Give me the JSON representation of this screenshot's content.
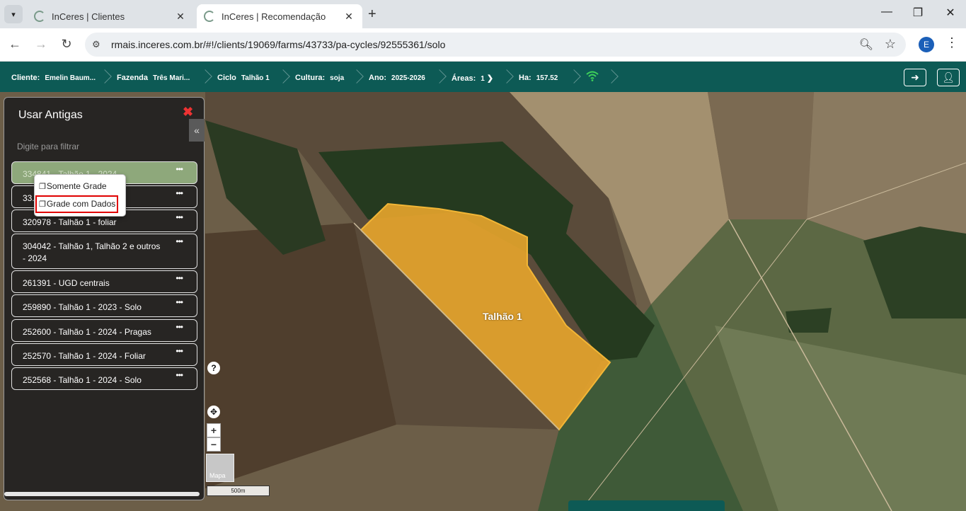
{
  "browser": {
    "tabs": [
      {
        "title": "InCeres | Clientes",
        "active": false
      },
      {
        "title": "InCeres | Recomendação",
        "active": true
      }
    ],
    "url": "rmais.inceres.com.br/#!/clients/19069/farms/43733/pa-cycles/92555361/solo",
    "profile_initial": "E"
  },
  "header": {
    "cliente_label": "Cliente:",
    "cliente_value": "Emelin Baum...",
    "fazenda_label": "Fazenda",
    "fazenda_value": "Três Mari...",
    "ciclo_label": "Ciclo",
    "ciclo_value": "Talhão 1",
    "cultura_label": "Cultura:",
    "cultura_value": "soja",
    "ano_label": "Ano:",
    "ano_value": "2025-2026",
    "areas_label": "Áreas:",
    "areas_value": "1",
    "ha_label": "Ha:",
    "ha_value": "157.52"
  },
  "panel": {
    "title": "Usar Antigas",
    "filter_placeholder": "Digite para filtrar",
    "items": [
      {
        "label": "334841 - Talhão 1 - 2024",
        "selected": true
      },
      {
        "label": "33...",
        "selected": false
      },
      {
        "label": "320978 - Talhão 1 - foliar",
        "selected": false
      },
      {
        "label": "304042 - Talhão 1, Talhão 2 e outros - 2024",
        "selected": false
      },
      {
        "label": "261391 - UGD centrais",
        "selected": false
      },
      {
        "label": "259890 - Talhão 1 - 2023 - Solo",
        "selected": false
      },
      {
        "label": "252600 - Talhão 1 - 2024 - Pragas",
        "selected": false
      },
      {
        "label": "252570 - Talhão 1 - 2024 - Foliar",
        "selected": false
      },
      {
        "label": "252568 - Talhão 1 - 2024 - Solo",
        "selected": false
      }
    ],
    "item_menu_glyph": "•••"
  },
  "context_menu": {
    "options": [
      "Somente Grade",
      "Grade com Dados"
    ],
    "highlighted": "Grade com Dados"
  },
  "map": {
    "field_label": "Talhão 1",
    "layer_label": "Mapa",
    "scale_label": "500m",
    "field_color": "#e3a32c"
  },
  "icons": {
    "tab_menu": "chevron-down-icon",
    "back": "arrow-left-icon",
    "forward": "arrow-right-icon",
    "reload": "reload-icon",
    "wifi": "wifi-icon",
    "exit": "exit-arrow-icon",
    "user": "user-icon"
  }
}
